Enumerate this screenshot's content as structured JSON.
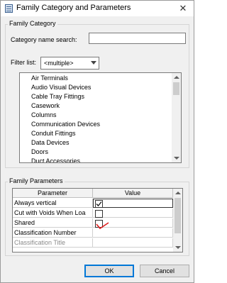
{
  "window": {
    "title": "Family Category and Parameters",
    "close_glyph": "✕"
  },
  "family_category": {
    "group_title": "Family Category",
    "search_label": "Category name search:",
    "search_value": "",
    "filter_label": "Filter list:",
    "filter_value": "<multiple>",
    "items": [
      "Air Terminals",
      "Audio Visual Devices",
      "Cable Tray Fittings",
      "Casework",
      "Columns",
      "Communication Devices",
      "Conduit Fittings",
      "Data Devices",
      "Doors",
      "Duct Accessories"
    ]
  },
  "family_parameters": {
    "group_title": "Family Parameters",
    "columns": [
      "Parameter",
      "Value"
    ],
    "rows": [
      {
        "name": "Always vertical",
        "checked": true
      },
      {
        "name": "Cut with Voids When Loa",
        "checked": false
      },
      {
        "name": "Shared",
        "checked": false,
        "annotation": "red-checkmark"
      },
      {
        "name": "Classification Number",
        "checked": null
      },
      {
        "name": "Classification Title",
        "checked": null,
        "disabled": true
      }
    ]
  },
  "buttons": {
    "ok": "OK",
    "cancel": "Cancel"
  },
  "colors": {
    "accent": "#0078d7",
    "annotation": "#e02020",
    "disabled_text": "#8a8a8a"
  }
}
